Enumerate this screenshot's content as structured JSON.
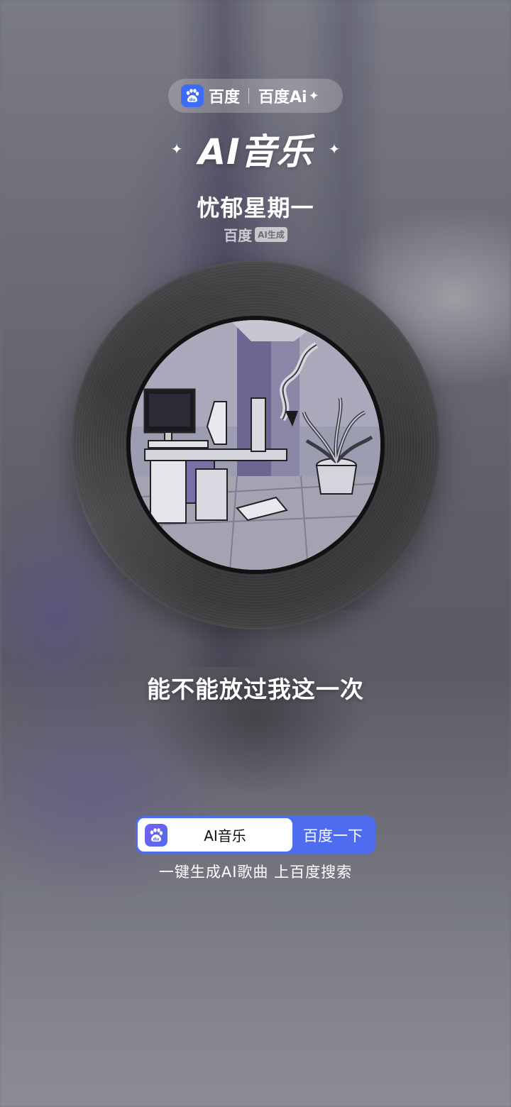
{
  "header": {
    "brand_name": "百度",
    "brand_ai": "百度Ai",
    "brand_ai_spark": "✦",
    "title": "AI音乐",
    "title_spark": "✦"
  },
  "song": {
    "title": "忧郁星期一",
    "credit_brand": "百度",
    "credit_tag": "AI生成",
    "lyric": "能不能放过我这一次"
  },
  "search": {
    "value": "AI音乐",
    "button_label": "百度一下",
    "tagline": "一键生成AI歌曲 上百度搜索"
  },
  "colors": {
    "accent": "#4e6cf0",
    "brand_blue": "#3d6df6"
  }
}
